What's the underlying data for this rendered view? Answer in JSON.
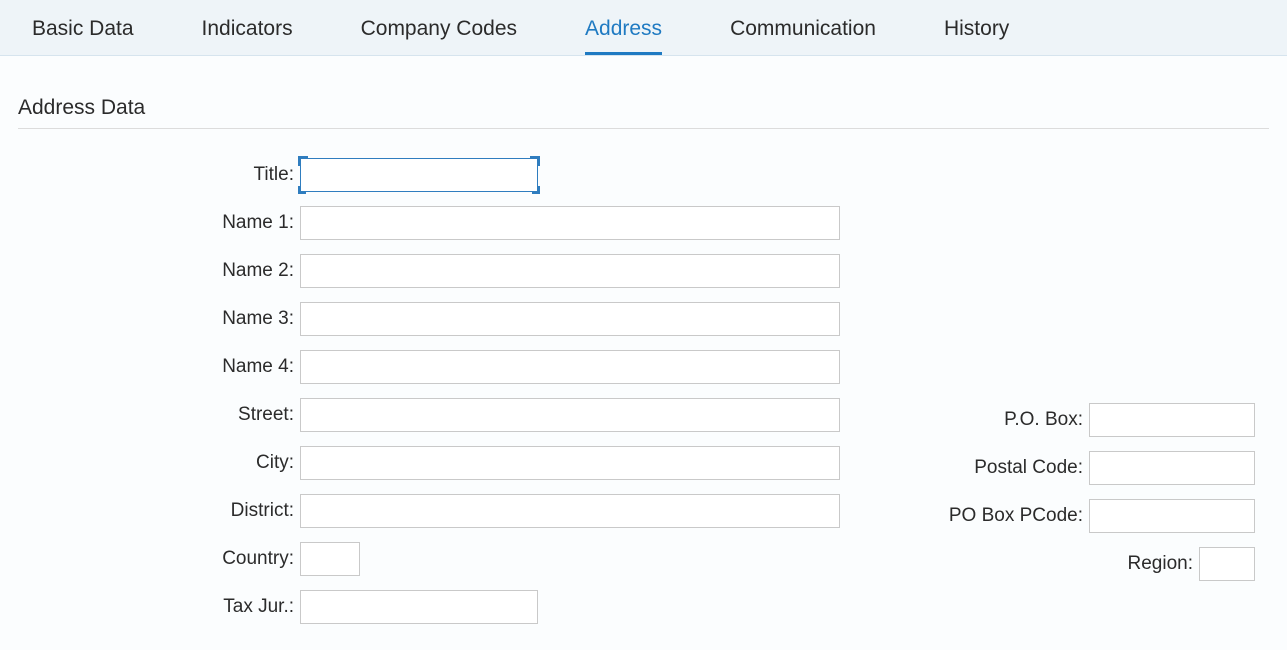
{
  "tabs": [
    {
      "label": "Basic Data",
      "active": false
    },
    {
      "label": "Indicators",
      "active": false
    },
    {
      "label": "Company Codes",
      "active": false
    },
    {
      "label": "Address",
      "active": true
    },
    {
      "label": "Communication",
      "active": false
    },
    {
      "label": "History",
      "active": false
    }
  ],
  "section": {
    "title": "Address Data"
  },
  "left": {
    "title": {
      "label": "Title:",
      "value": ""
    },
    "name1": {
      "label": "Name 1:",
      "value": ""
    },
    "name2": {
      "label": "Name 2:",
      "value": ""
    },
    "name3": {
      "label": "Name 3:",
      "value": ""
    },
    "name4": {
      "label": "Name 4:",
      "value": ""
    },
    "street": {
      "label": "Street:",
      "value": ""
    },
    "city": {
      "label": "City:",
      "value": ""
    },
    "district": {
      "label": "District:",
      "value": ""
    },
    "country": {
      "label": "Country:",
      "value": ""
    },
    "taxjur": {
      "label": "Tax Jur.:",
      "value": ""
    }
  },
  "right": {
    "pobox": {
      "label": "P.O. Box:",
      "value": ""
    },
    "postalcode": {
      "label": "Postal Code:",
      "value": ""
    },
    "poboxpcode": {
      "label": "PO Box PCode:",
      "value": ""
    },
    "region": {
      "label": "Region:",
      "value": ""
    }
  }
}
